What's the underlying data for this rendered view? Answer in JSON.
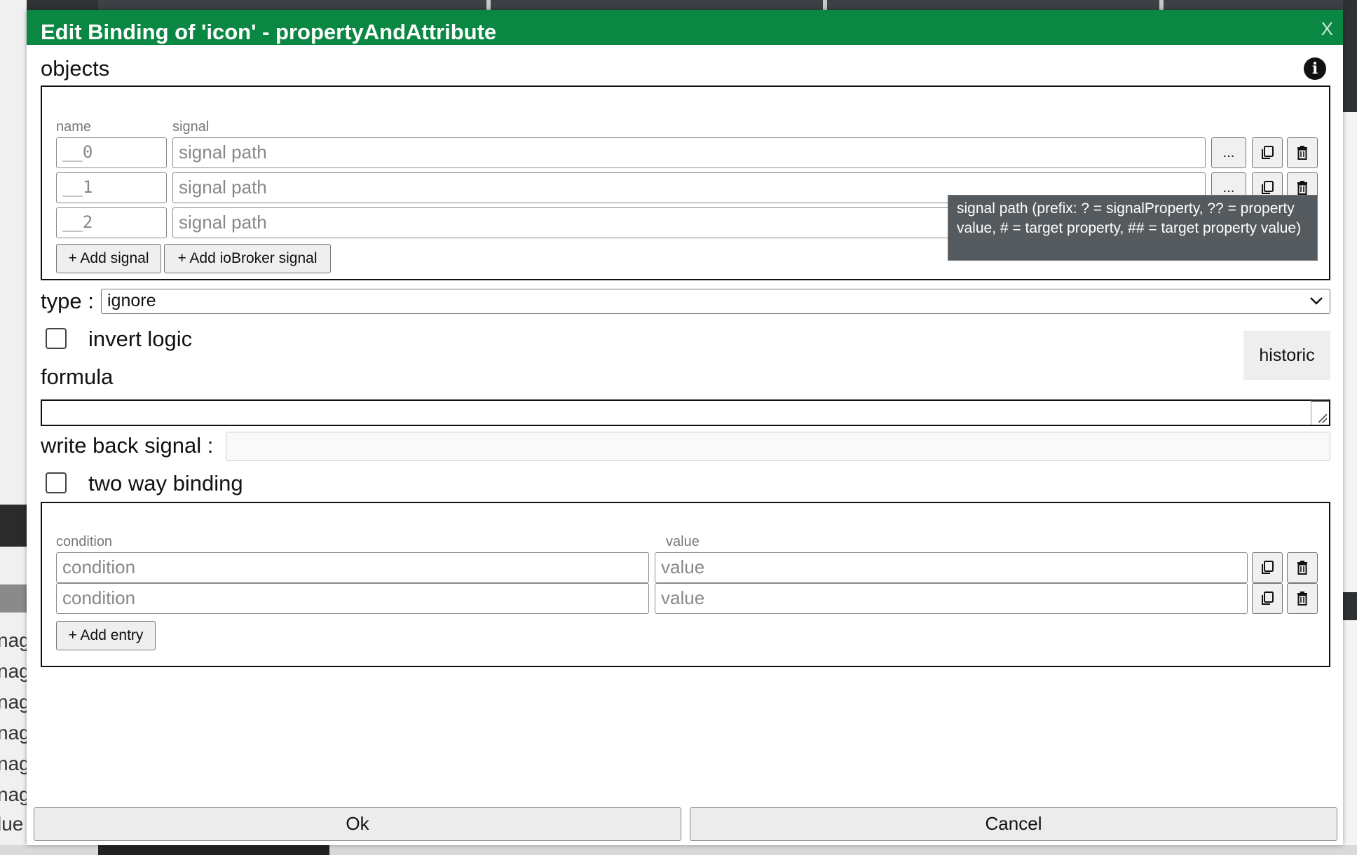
{
  "dialog": {
    "title": "Edit Binding of 'icon' - propertyAndAttribute",
    "close_label": "X"
  },
  "objects": {
    "section_label": "objects",
    "columns": {
      "name": "name",
      "signal": "signal"
    },
    "rows": [
      {
        "name": "__0",
        "signal_placeholder": "signal path",
        "browse_label": "..."
      },
      {
        "name": "__1",
        "signal_placeholder": "signal path",
        "browse_label": "..."
      },
      {
        "name": "__2",
        "signal_placeholder": "signal path"
      }
    ],
    "add_signal_label": "+ Add signal",
    "add_iobroker_label": "+ Add ioBroker signal"
  },
  "tooltip": {
    "text": "signal path (prefix: ? = signalProperty, ?? = property value, # = target property, ## = target property value)"
  },
  "type": {
    "label": "type :",
    "selected": "ignore"
  },
  "invert_logic": {
    "label": "invert logic",
    "checked": false
  },
  "historic_label": "historic",
  "formula": {
    "label": "formula",
    "value": ""
  },
  "write_back": {
    "label": "write back signal :",
    "value": ""
  },
  "two_way": {
    "label": "two way binding",
    "checked": false
  },
  "conditions": {
    "columns": {
      "condition": "condition",
      "value": "value"
    },
    "rows": [
      {
        "condition_placeholder": "condition",
        "value_placeholder": "value"
      },
      {
        "condition_placeholder": "condition",
        "value_placeholder": "value"
      }
    ],
    "add_entry_label": "+ Add entry"
  },
  "footer": {
    "ok_label": "Ok",
    "cancel_label": "Cancel"
  },
  "background": {
    "left_fragments": [
      "nag",
      "nag",
      "nag",
      "nag",
      "nag",
      "nag",
      "lue"
    ]
  },
  "colors": {
    "titlebar": "#0a8843",
    "tooltip": "#555a5e"
  }
}
